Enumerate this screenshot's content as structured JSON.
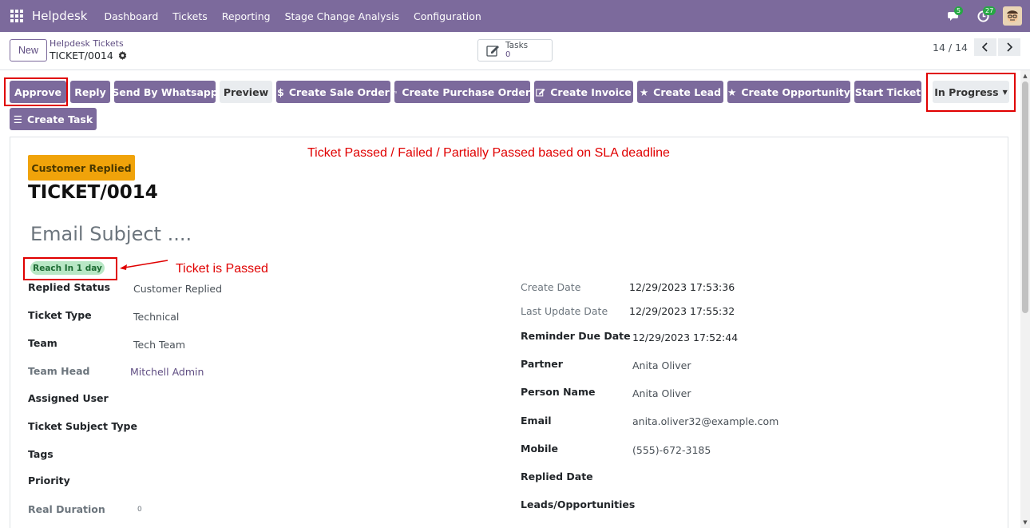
{
  "navbar": {
    "brand": "Helpdesk",
    "menu": [
      "Dashboard",
      "Tickets",
      "Reporting",
      "Stage Change Analysis",
      "Configuration"
    ],
    "messages_count": "5",
    "activities_count": "27"
  },
  "control_panel": {
    "new_label": "New",
    "breadcrumb_parent": "Helpdesk Tickets",
    "breadcrumb_current": "TICKET/0014",
    "tasks_label": "Tasks",
    "tasks_count": "0",
    "pager": "14 / 14"
  },
  "actions": {
    "approve": "Approve",
    "reply": "Reply",
    "send_whatsapp": "Send By Whatsapp",
    "preview": "Preview",
    "create_sale_order": "Create Sale Order",
    "create_purchase_order": "Create Purchase Order",
    "create_invoice": "Create Invoice",
    "create_lead": "Create Lead",
    "create_opportunity": "Create Opportunity",
    "start_ticket": "Start Ticket",
    "create_task": "Create Task",
    "status": "In Progress"
  },
  "annotations": {
    "sla_note": "Ticket Passed / Failed / Partially Passed based on SLA deadline",
    "passed_note": "Ticket is Passed"
  },
  "form": {
    "stage": "Customer Replied",
    "title": "TICKET/0014",
    "email_subject": "Email Subject ....",
    "sla": "Reach In 1 day",
    "left": {
      "replied_status_label": "Replied Status",
      "replied_status_value": "Customer Replied",
      "ticket_type_label": "Ticket Type",
      "ticket_type_value": "Technical",
      "team_label": "Team",
      "team_value": "Tech Team",
      "team_head_label": "Team Head",
      "team_head_value": "Mitchell Admin",
      "assigned_user_label": "Assigned User",
      "ticket_subject_type_label": "Ticket Subject Type",
      "tags_label": "Tags",
      "priority_label": "Priority",
      "real_duration_label": "Real Duration",
      "real_duration_value": "0"
    },
    "right": {
      "create_date_label": "Create Date",
      "create_date_value": "12/29/2023 17:53:36",
      "last_update_label": "Last Update Date",
      "last_update_value": "12/29/2023 17:55:32",
      "reminder_label": "Reminder Due Date",
      "reminder_value": "12/29/2023 17:52:44",
      "partner_label": "Partner",
      "partner_value": "Anita Oliver",
      "person_name_label": "Person Name",
      "person_name_value": "Anita Oliver",
      "email_label": "Email",
      "email_value": "anita.oliver32@example.com",
      "mobile_label": "Mobile",
      "mobile_value": "(555)-672-3185",
      "replied_date_label": "Replied Date",
      "leads_label": "Leads/Opportunities"
    }
  },
  "colors": {
    "navbar": "#7c6a9c",
    "primary_button": "#7c6a9c",
    "stage_badge": "#f0a30a",
    "sla_badge": "#b8e7c5",
    "annotation": "#e00000"
  }
}
